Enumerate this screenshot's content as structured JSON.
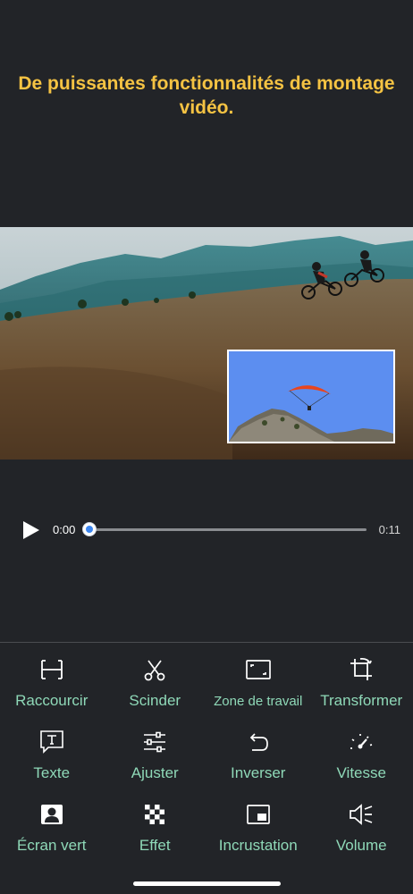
{
  "headline": "De puissantes fonctionnalités de montage vidéo.",
  "player": {
    "current_time": "0:00",
    "total_time": "0:11",
    "progress": 0
  },
  "colors": {
    "headline": "#f5c343",
    "tool_label": "#8fd9b8",
    "accent": "#3c86f0",
    "background": "#222428"
  },
  "tools": [
    {
      "label": "Raccourcir",
      "icon": "trim-icon"
    },
    {
      "label": "Scinder",
      "icon": "scissors-icon"
    },
    {
      "label": "Zone de travail",
      "icon": "canvas-icon"
    },
    {
      "label": "Transformer",
      "icon": "crop-rotate-icon"
    },
    {
      "label": "Texte",
      "icon": "text-bubble-icon"
    },
    {
      "label": "Ajuster",
      "icon": "sliders-icon"
    },
    {
      "label": "Inverser",
      "icon": "undo-arrow-icon"
    },
    {
      "label": "Vitesse",
      "icon": "speedometer-icon"
    },
    {
      "label": "Écran vert",
      "icon": "portrait-icon"
    },
    {
      "label": "Effet",
      "icon": "checkerboard-icon"
    },
    {
      "label": "Incrustation",
      "icon": "picture-in-picture-icon"
    },
    {
      "label": "Volume",
      "icon": "speaker-mute-icon"
    }
  ]
}
